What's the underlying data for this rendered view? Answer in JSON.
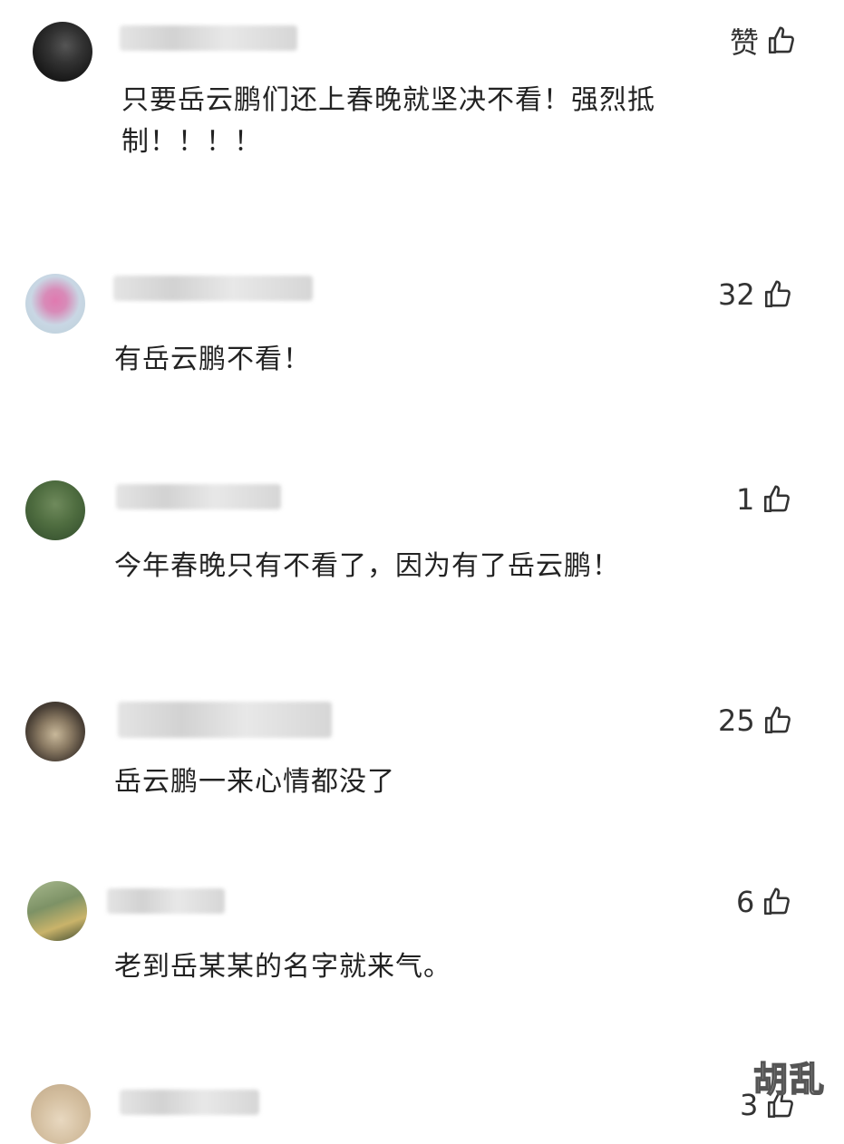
{
  "comments": [
    {
      "text": "只要岳云鹏们还上春晚就坚决不看！强烈抵\n制！！！！",
      "like_label": "赞"
    },
    {
      "text": "有岳云鹏不看！",
      "like_label": "32"
    },
    {
      "text": "今年春晚只有不看了，因为有了岳云鹏！",
      "like_label": "1"
    },
    {
      "text": "岳云鹏一来心情都没了",
      "like_label": "25"
    },
    {
      "text": "老到岳某某的名字就来气。",
      "like_label": "6"
    },
    {
      "text": "",
      "like_label": "3"
    }
  ],
  "icons": {
    "like": "thumbs-up-icon"
  },
  "watermark": "胡乱"
}
